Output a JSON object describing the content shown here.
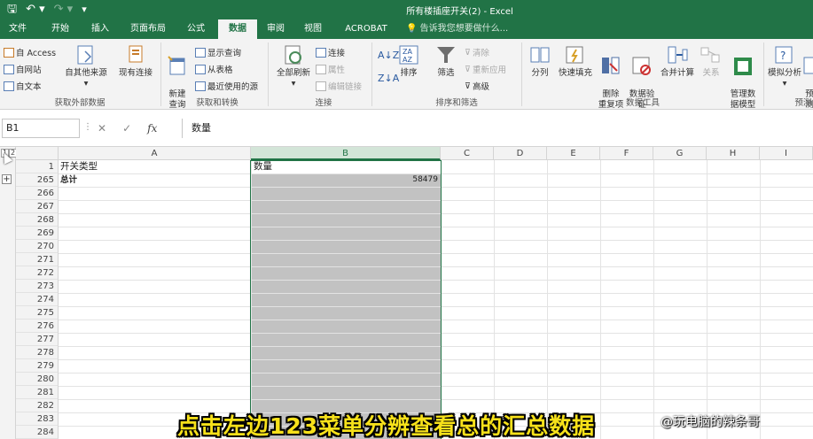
{
  "titlebar": {
    "title": "所有楼插座开关(2) - Excel",
    "save_icon": "save-icon",
    "undo_icon": "undo-icon",
    "redo_icon": "redo-icon"
  },
  "tabs": [
    "文件",
    "开始",
    "插入",
    "页面布局",
    "公式",
    "数据",
    "审阅",
    "视图",
    "ACROBAT"
  ],
  "active_tab": "数据",
  "tell_me": "告诉我您想要做什么...",
  "ribbon": {
    "get_external": {
      "access": "自 Access",
      "web": "自网站",
      "text": "自文本",
      "other": "自其他来源",
      "existing": "现有连接",
      "label": "获取外部数据"
    },
    "get_transform": {
      "new_query": "新建\n查询",
      "show_query": "显示查询",
      "from_table": "从表格",
      "recent_sources": "最近使用的源",
      "label": "获取和转换"
    },
    "connections": {
      "refresh_all": "全部刷新",
      "connections": "连接",
      "properties": "属性",
      "edit_links": "编辑链接",
      "label": "连接"
    },
    "sort_filter": {
      "sort": "排序",
      "filter": "筛选",
      "clear": "清除",
      "reapply": "重新应用",
      "advanced": "高级",
      "label": "排序和筛选"
    },
    "data_tools": {
      "text_to_columns": "分列",
      "flash_fill": "快速填充",
      "remove_duplicates": "删除\n重复项",
      "data_validation": "数据验\n证",
      "consolidate": "合并计算",
      "relationships": "关系",
      "manage_model": "管理数\n据模型",
      "label": "数据工具"
    },
    "forecast": {
      "what_if": "模拟分析",
      "forecast": "预测\n工",
      "label": "预测"
    }
  },
  "formula_bar": {
    "name_box": "B1",
    "cancel": "✕",
    "enter": "✓",
    "fx": "fx",
    "content": "数量"
  },
  "outline_levels": [
    "1",
    "2",
    "3"
  ],
  "columns": [
    "A",
    "B",
    "C",
    "D",
    "E",
    "F",
    "G",
    "H",
    "I"
  ],
  "selected_column": "B",
  "rows": [
    "1",
    "265",
    "266",
    "267",
    "268",
    "269",
    "270",
    "271",
    "272",
    "273",
    "274",
    "275",
    "276",
    "277",
    "278",
    "279",
    "280",
    "281",
    "282",
    "283",
    "284"
  ],
  "cells": {
    "a1": "开关类型",
    "b1": "数量",
    "a265": "总计",
    "b265": "58479"
  },
  "subtitle": "点击左边123菜单分辨查看总的汇总数据",
  "watermark": "@玩电脑的辣条哥"
}
